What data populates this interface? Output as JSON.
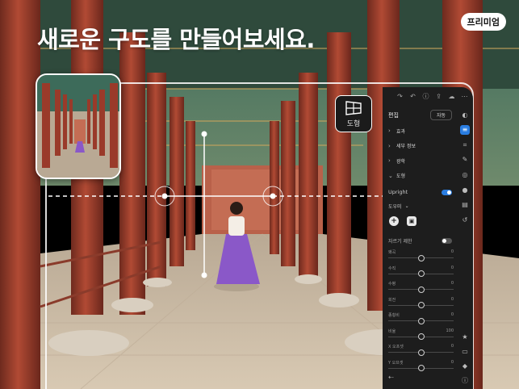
{
  "headline": "새로운 구도를 만들어보세요.",
  "premium_badge": "프리미엄",
  "geometry_tool": {
    "icon": "geometry-grid-icon",
    "label": "도형"
  },
  "panel": {
    "top_icons": [
      "redo-icon",
      "undo-icon",
      "help-icon",
      "share-icon",
      "cloud-icon",
      "more-icon"
    ],
    "edit_title": "편집",
    "auto_label": "자동",
    "sections": [
      {
        "label": "효과",
        "expanded": false
      },
      {
        "label": "세부 정보",
        "expanded": false
      },
      {
        "label": "광학",
        "expanded": false
      },
      {
        "label": "도형",
        "expanded": true
      }
    ],
    "upright": {
      "label": "Upright",
      "on": true
    },
    "guide_select": "도우미",
    "guide_tools": [
      {
        "name": "add-guide-icon",
        "glyph": "+"
      },
      {
        "name": "delete-guide-icon",
        "glyph": "🗑"
      }
    ],
    "constrain": {
      "label": "자르기 제한",
      "on": false
    },
    "sliders": [
      {
        "label": "왜곡",
        "value": "0",
        "level": 0.5
      },
      {
        "label": "수직",
        "value": "0",
        "level": 0.5
      },
      {
        "label": "수평",
        "value": "0",
        "level": 0.5
      },
      {
        "label": "회전",
        "value": "0",
        "level": 0.5
      },
      {
        "label": "종횡비",
        "value": "0",
        "level": 0.5
      },
      {
        "label": "비율",
        "value": "100",
        "level": 0.5
      },
      {
        "label": "X 오프셋",
        "value": "0",
        "level": 0.5
      },
      {
        "label": "Y 오프셋",
        "value": "0",
        "level": 0.5
      }
    ],
    "rail_icons": [
      {
        "name": "presets-icon",
        "glyph": "◐",
        "active": false
      },
      {
        "name": "edit-sliders-icon",
        "glyph": "≡",
        "active": true
      },
      {
        "name": "crop-icon",
        "glyph": "⌗",
        "active": false
      },
      {
        "name": "healing-icon",
        "glyph": "✎",
        "active": false
      },
      {
        "name": "masking-icon",
        "glyph": "◎",
        "active": false
      },
      {
        "name": "color-icon",
        "glyph": "●",
        "active": false
      },
      {
        "name": "versions-icon",
        "glyph": "▤",
        "active": false
      },
      {
        "name": "history-icon",
        "glyph": "↺",
        "active": false
      }
    ],
    "rail_bottom_icons": [
      {
        "name": "rating-star-icon",
        "glyph": "★"
      },
      {
        "name": "comment-icon",
        "glyph": "▭"
      },
      {
        "name": "tag-icon",
        "glyph": "◆"
      },
      {
        "name": "info-icon",
        "glyph": "ⓘ"
      }
    ]
  },
  "colors": {
    "pillar": "#9a3a2a",
    "floor": "#cdbca5",
    "accent": "#2a7de1",
    "dress": "#8a58c8"
  }
}
